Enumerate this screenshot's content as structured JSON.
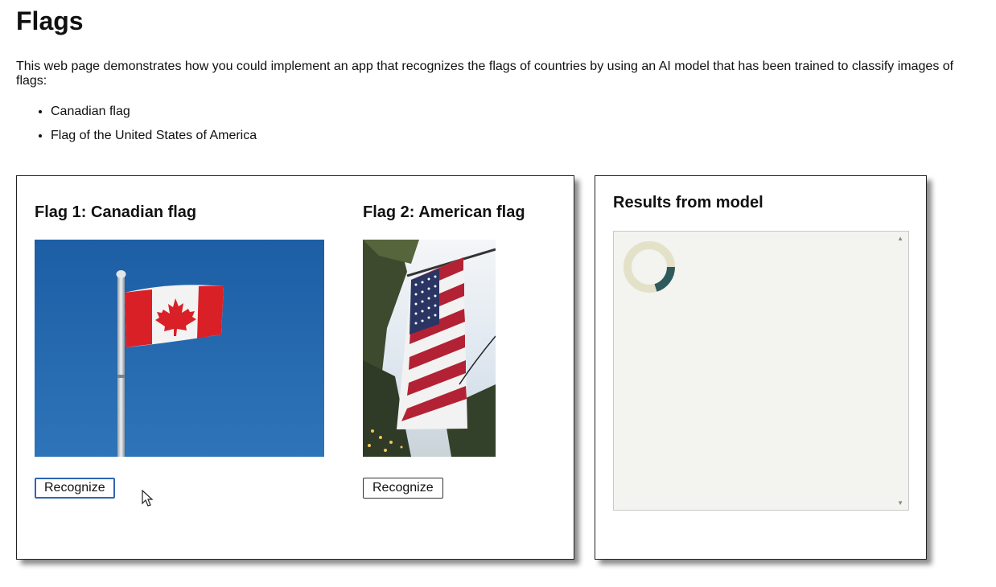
{
  "page": {
    "title": "Flags",
    "intro": "This web page demonstrates how you could implement an app that recognizes the flags of countries by using an AI model that has been trained to classify images of flags:",
    "list": [
      "Canadian flag",
      "Flag of the United States of America"
    ]
  },
  "flags_panel": {
    "flag1": {
      "heading": "Flag 1: Canadian flag",
      "button": "Recognize"
    },
    "flag2": {
      "heading": "Flag 2: American flag",
      "button": "Recognize"
    }
  },
  "results_panel": {
    "heading": "Results from model",
    "spinner_icon": "loading-spinner-icon"
  },
  "colors": {
    "focus_border": "#2f66b3",
    "results_bg": "#f3f3ef",
    "spinner_track": "#e4e1c9",
    "spinner_arc": "#2f5a5c"
  }
}
